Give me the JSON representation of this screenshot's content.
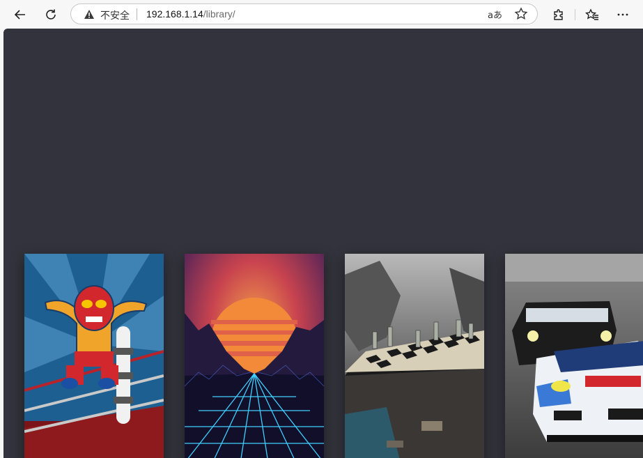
{
  "browser": {
    "security_label": "不安全",
    "url_host": "192.168.1.14",
    "url_path": "/library/",
    "read_aloud_label": "aあ"
  },
  "library": {
    "cards": [
      {
        "name": "wrestler-cover",
        "icon": "luchador-wrestler-art"
      },
      {
        "name": "synthwave-cover",
        "icon": "synthwave-sunset-art"
      },
      {
        "name": "chess-cover",
        "icon": "floating-chessboard-art"
      },
      {
        "name": "racing-cover",
        "icon": "race-car-art"
      }
    ]
  },
  "colors": {
    "page_bg": "#33333d",
    "toolbar_bg": "#f7f7f7"
  }
}
